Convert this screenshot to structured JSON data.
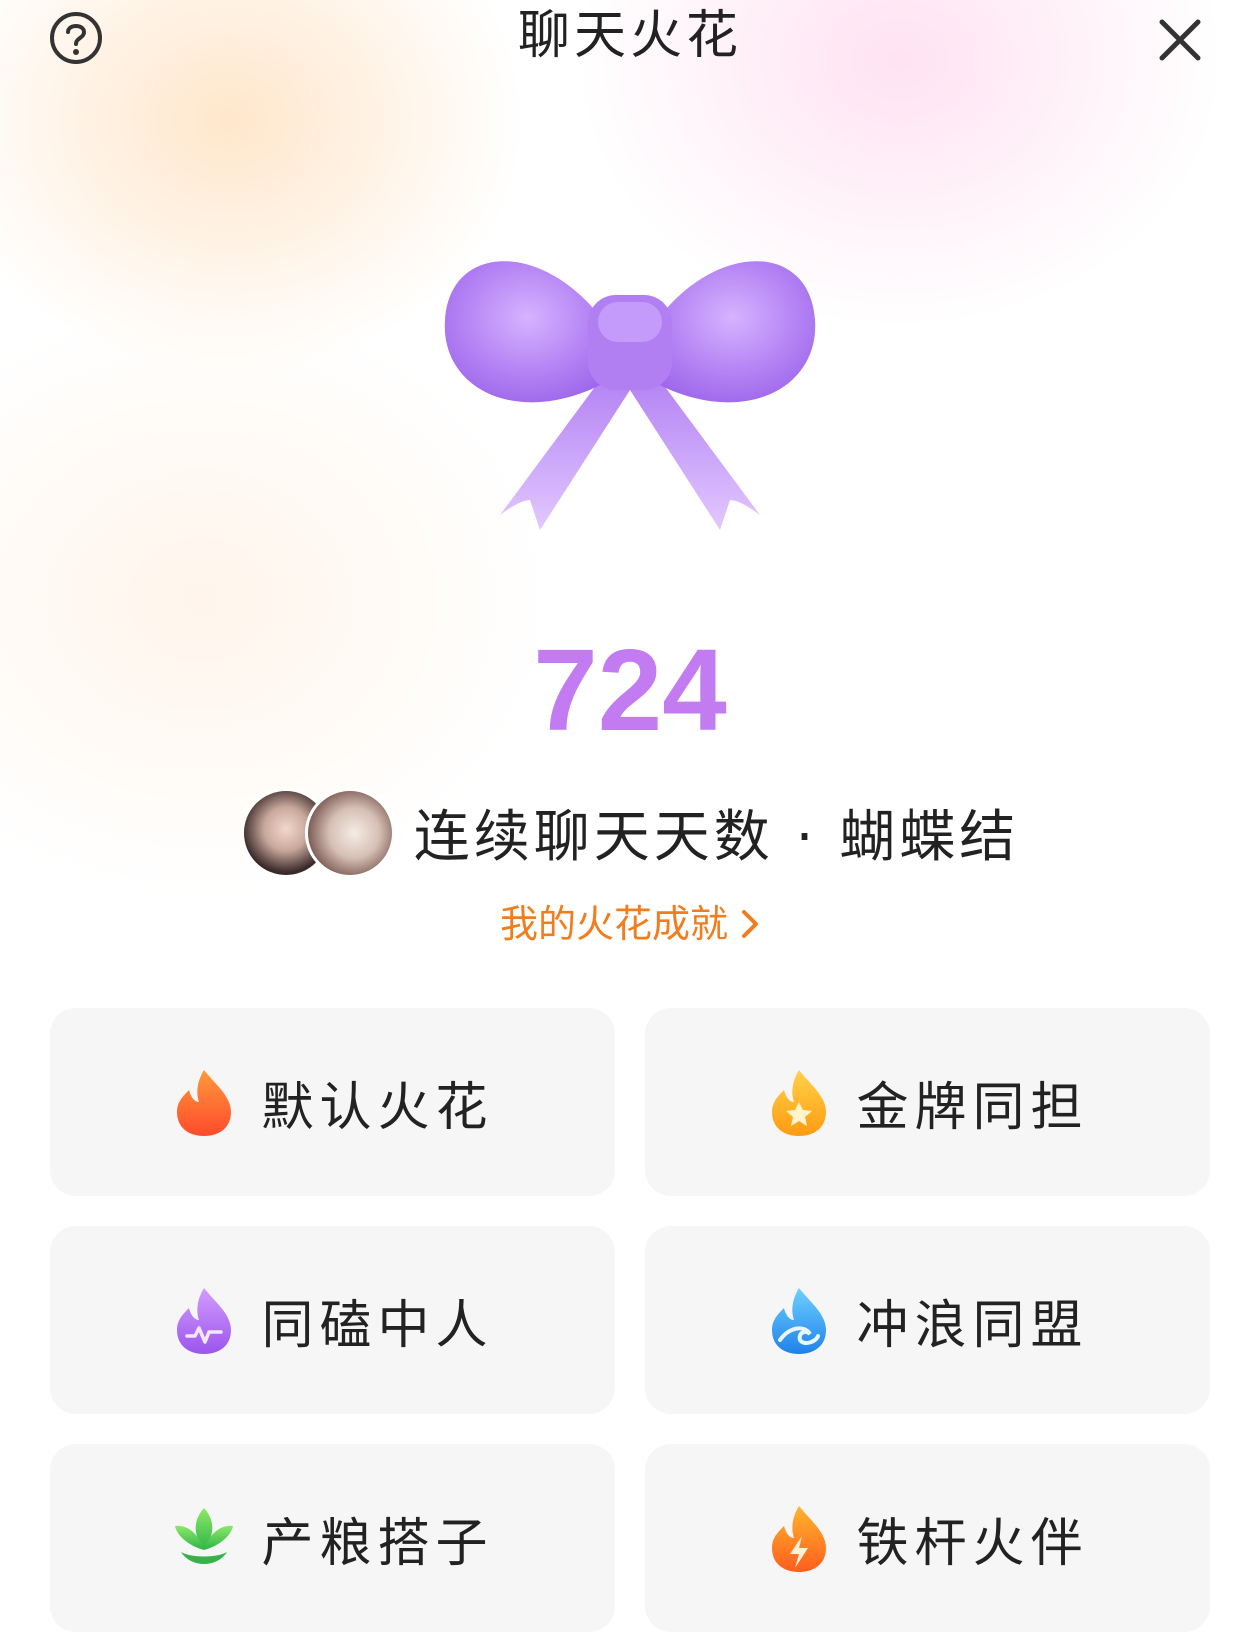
{
  "header": {
    "title": "聊天火花"
  },
  "streak": {
    "days": "724",
    "label": "连续聊天天数 · 蝴蝶结"
  },
  "achievement_link": {
    "label": "我的火花成就"
  },
  "spark_types": [
    {
      "label": "默认火花",
      "icon": "fire-icon",
      "color": "#ff6a2b"
    },
    {
      "label": "金牌同担",
      "icon": "star-flame-icon",
      "color": "#ffb01a"
    },
    {
      "label": "同磕中人",
      "icon": "pulse-flame-icon",
      "color": "#b06cf2"
    },
    {
      "label": "冲浪同盟",
      "icon": "wave-flame-icon",
      "color": "#2e9cf2"
    },
    {
      "label": "产粮搭子",
      "icon": "leaf-icon",
      "color": "#47c94b"
    },
    {
      "label": "铁杆火伴",
      "icon": "bolt-flame-icon",
      "color": "#ff7a1a"
    }
  ],
  "colors": {
    "count": "#c27bf0",
    "link": "#f07e1f",
    "bow": "#b98af5"
  }
}
